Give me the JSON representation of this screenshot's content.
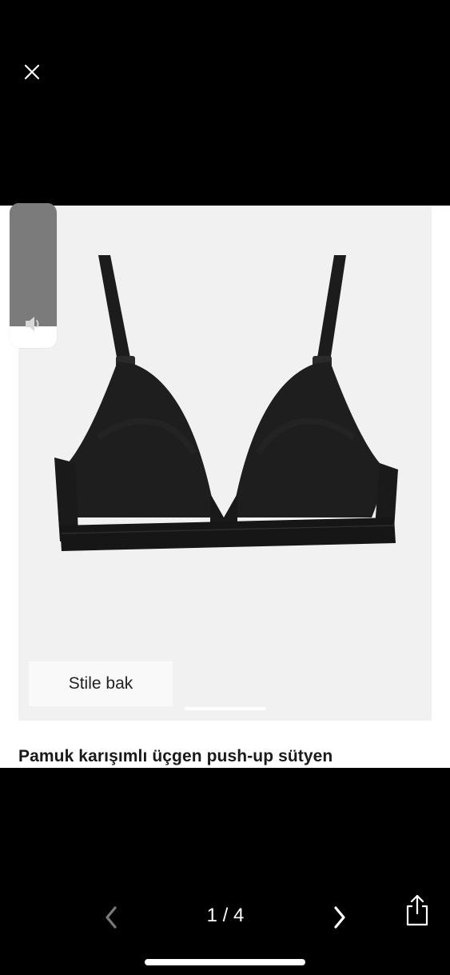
{
  "viewer": {
    "close_icon": "close-icon",
    "page_counter": "1 / 4",
    "prev_icon": "chevron-left-icon",
    "next_icon": "chevron-right-icon",
    "share_icon": "share-icon"
  },
  "product": {
    "title": "Pamuk karışımlı üçgen push-up sütyen",
    "style_button": "Stile bak",
    "image_index": 1,
    "image_count": 4
  },
  "volume": {
    "icon": "speaker-icon",
    "level": 0.15
  },
  "colors": {
    "background": "#000000",
    "photo_background": "#f1f1f2",
    "product": "#1c1c1c",
    "hud_fill": "#7b7b7b"
  }
}
